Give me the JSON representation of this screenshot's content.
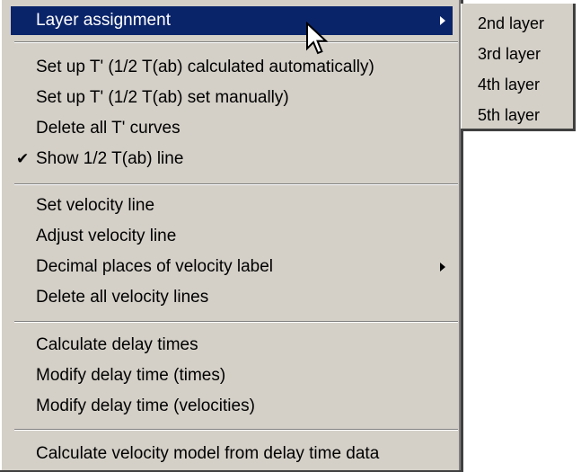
{
  "menu": {
    "items": [
      {
        "label": "Layer assignment",
        "has_submenu": true,
        "highlighted": true
      },
      {
        "label": "Set up T' (1/2 T(ab) calculated automatically)"
      },
      {
        "label": "Set up T' (1/2 T(ab) set manually)"
      },
      {
        "label": "Delete all T' curves"
      },
      {
        "label": "Show 1/2 T(ab) line",
        "checked": true
      },
      {
        "label": "Set velocity line"
      },
      {
        "label": "Adjust velocity line"
      },
      {
        "label": "Decimal places of velocity label",
        "has_submenu": true
      },
      {
        "label": "Delete all velocity lines"
      },
      {
        "label": "Calculate delay times"
      },
      {
        "label": "Modify delay time (times)"
      },
      {
        "label": "Modify delay time (velocities)"
      },
      {
        "label": "Calculate velocity model from delay time data"
      }
    ],
    "check_glyph": "✔",
    "highlight_color": "#0a246a",
    "background_color": "#d4d0c8"
  },
  "submenu": {
    "items": [
      {
        "label": "2nd layer"
      },
      {
        "label": "3rd layer"
      },
      {
        "label": "4th layer"
      },
      {
        "label": "5th layer"
      }
    ]
  },
  "cursor": {
    "icon": "arrow-pointer-icon"
  }
}
